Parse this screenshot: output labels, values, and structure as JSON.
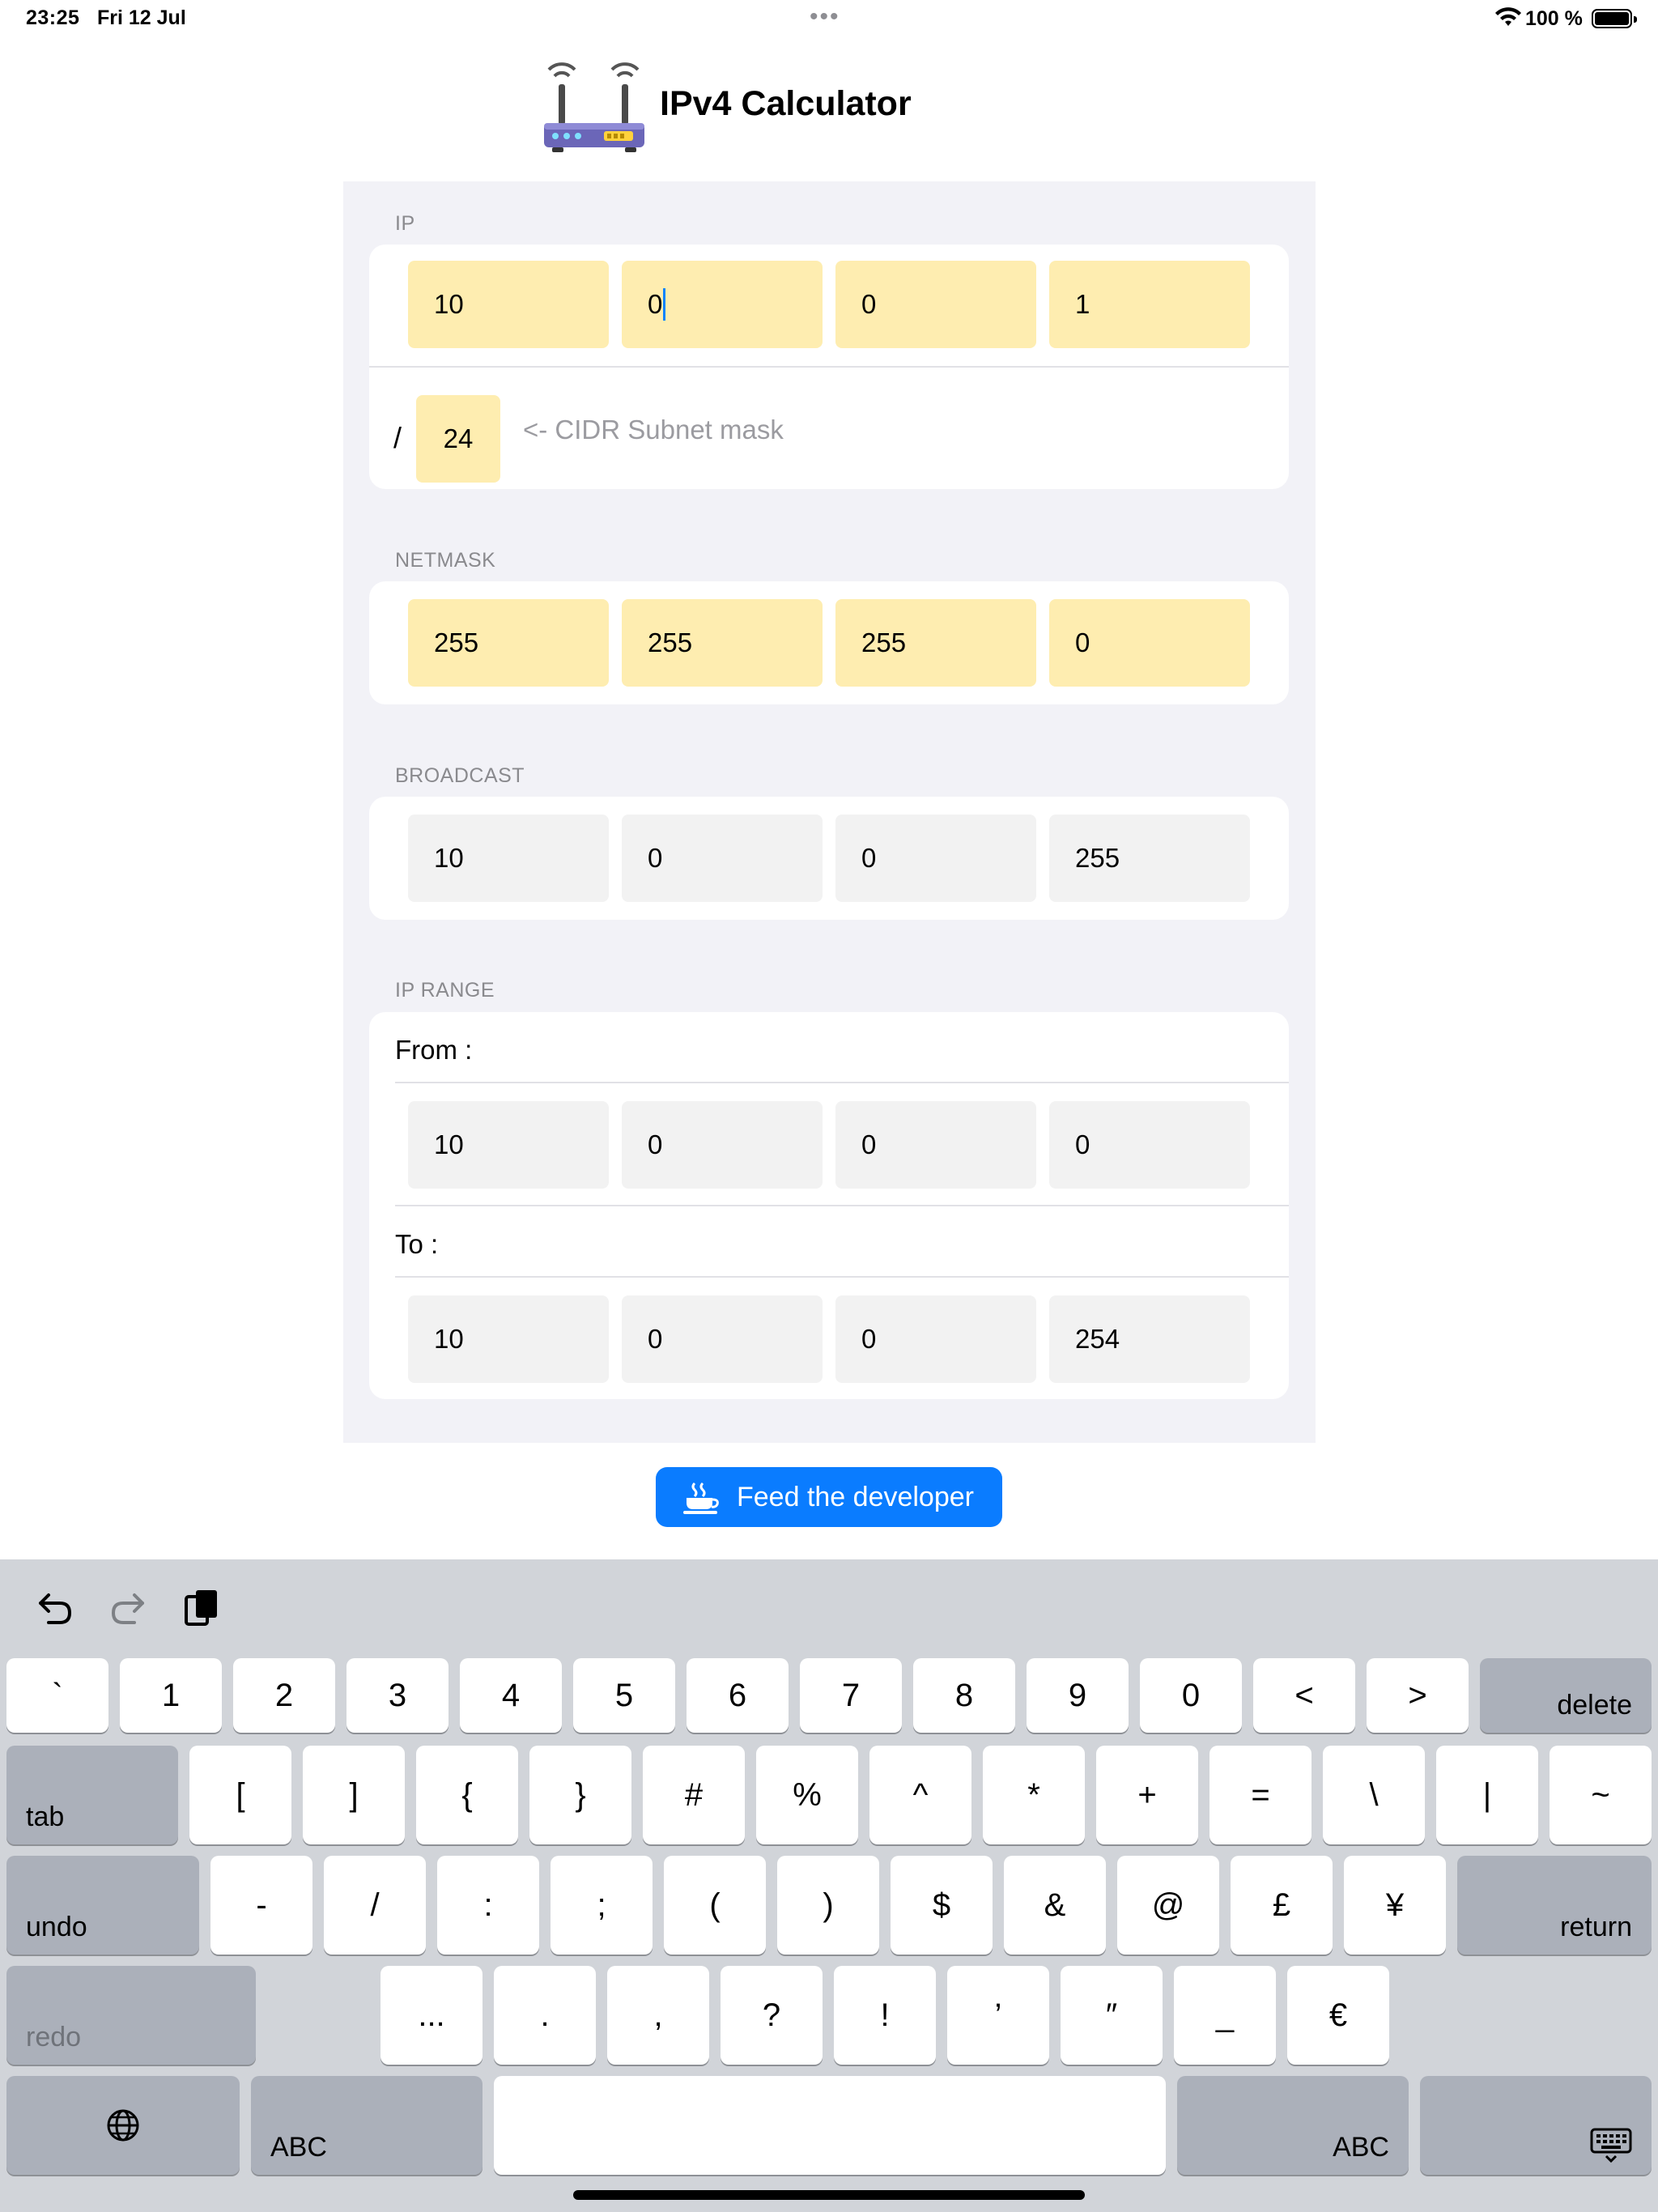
{
  "status": {
    "time": "23:25",
    "date": "Fri 12 Jul",
    "dots": "•••",
    "battery": "100 %"
  },
  "app": {
    "title": "IPv4 Calculator",
    "logo_icon": "router-icon"
  },
  "ip": {
    "label": "IP",
    "octets": [
      "10",
      "0",
      "0",
      "1"
    ],
    "cidr_slash": "/",
    "cidr": "24",
    "cidr_hint": "<- CIDR Subnet mask"
  },
  "netmask": {
    "label": "NETMASK",
    "octets": [
      "255",
      "255",
      "255",
      "0"
    ]
  },
  "broadcast": {
    "label": "BROADCAST",
    "octets": [
      "10",
      "0",
      "0",
      "255"
    ]
  },
  "range": {
    "label": "IP RANGE",
    "from_label": "From :",
    "from": [
      "10",
      "0",
      "0",
      "0"
    ],
    "to_label": "To :",
    "to": [
      "10",
      "0",
      "0",
      "254"
    ]
  },
  "feed_button": {
    "label": "Feed the developer",
    "icon": "coffee-cup-icon"
  },
  "keyboard": {
    "toolbar": [
      "undo-icon",
      "redo-icon",
      "paste-icon"
    ],
    "row1": [
      "`",
      "1",
      "2",
      "3",
      "4",
      "5",
      "6",
      "7",
      "8",
      "9",
      "0",
      "<",
      ">"
    ],
    "delete": "delete",
    "tab": "tab",
    "row2": [
      "[",
      "]",
      "{",
      "}",
      "#",
      "%",
      "^",
      "*",
      "+",
      "=",
      "\\",
      "|",
      "~"
    ],
    "undo": "undo",
    "row3": [
      "-",
      "/",
      ":",
      ";",
      "(",
      ")",
      "$",
      "&",
      "@",
      "£",
      "¥"
    ],
    "return": "return",
    "redo": "redo",
    "row4": [
      "...",
      ".",
      ",",
      "?",
      "!",
      "’",
      "″",
      "_",
      "€"
    ],
    "abc_left": "ABC",
    "abc_right": "ABC",
    "globe_icon": "globe-icon",
    "hide_icon": "keyboard-hide-icon"
  },
  "colors": {
    "editable_field": "#feedb0",
    "readonly_field": "#f2f2f2",
    "accent": "#0a7cff"
  }
}
